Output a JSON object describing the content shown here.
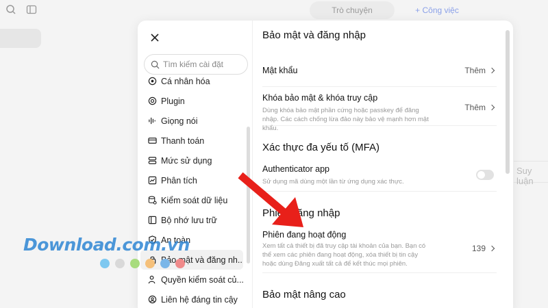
{
  "background": {
    "tabs": [
      {
        "label": "Trò chuyện"
      },
      {
        "label": "+ Công việc"
      }
    ],
    "side_text": "Suy luận"
  },
  "search": {
    "placeholder": "Tìm kiếm cài đặt"
  },
  "nav": {
    "items": [
      {
        "label": "Cá nhân hóa",
        "icon": "personalize-icon"
      },
      {
        "label": "Plugin",
        "icon": "at-icon"
      },
      {
        "label": "Giọng nói",
        "icon": "voice-wave-icon"
      },
      {
        "label": "Thanh toán",
        "icon": "card-icon"
      },
      {
        "label": "Mức sử dụng",
        "icon": "usage-icon"
      },
      {
        "label": "Phân tích",
        "icon": "chart-icon"
      },
      {
        "label": "Kiểm soát dữ liệu",
        "icon": "data-control-icon"
      },
      {
        "label": "Bộ nhớ lưu trữ",
        "icon": "storage-icon"
      },
      {
        "label": "An toàn",
        "icon": "shield-icon"
      },
      {
        "label": "Bảo mật và đăng nh...",
        "icon": "lock-icon"
      },
      {
        "label": "Quyền kiểm soát củ...",
        "icon": "person-control-icon"
      },
      {
        "label": "Liên hệ đáng tin cậy",
        "icon": "contact-icon"
      }
    ],
    "active_index": 9
  },
  "content": {
    "section1": {
      "title": "Bảo mật và đăng nhập",
      "password": {
        "label": "Mật khẩu",
        "action": "Thêm"
      },
      "passkey": {
        "label": "Khóa bảo mật & khóa truy cập",
        "desc": "Dùng khóa bảo mật phần cứng hoặc passkey để đăng nhập. Các cách chống lừa đảo này bảo vệ mạnh hơn mật khẩu.",
        "action": "Thêm"
      }
    },
    "section2": {
      "title": "Xác thực đa yếu tố (MFA)",
      "authenticator": {
        "label": "Authenticator app",
        "desc": "Sử dụng mã dùng một lần từ ứng dụng xác thực.",
        "enabled": false
      }
    },
    "section3": {
      "title": "Phiên đăng nhập",
      "sessions": {
        "label": "Phiên đang hoạt động",
        "desc": "Xem tất cả thiết bị đã truy cập tài khoản của bạn. Bạn có thể xem các phiên đang hoạt động, xóa thiết bị tin cậy hoặc dùng Đăng xuất tất cả để kết thúc mọi phiên.",
        "count": "139"
      }
    },
    "section4": {
      "title": "Bảo mật nâng cao"
    }
  },
  "watermark": {
    "text": "Download.com.vn",
    "dot_colors": [
      "#7ec8f0",
      "#d9d9d9",
      "#a8dc7e",
      "#f5c07a",
      "#7ab6e8",
      "#f08a8a"
    ]
  },
  "colors": {
    "arrow": "#e8201a",
    "watermark": "#2e86d4"
  }
}
